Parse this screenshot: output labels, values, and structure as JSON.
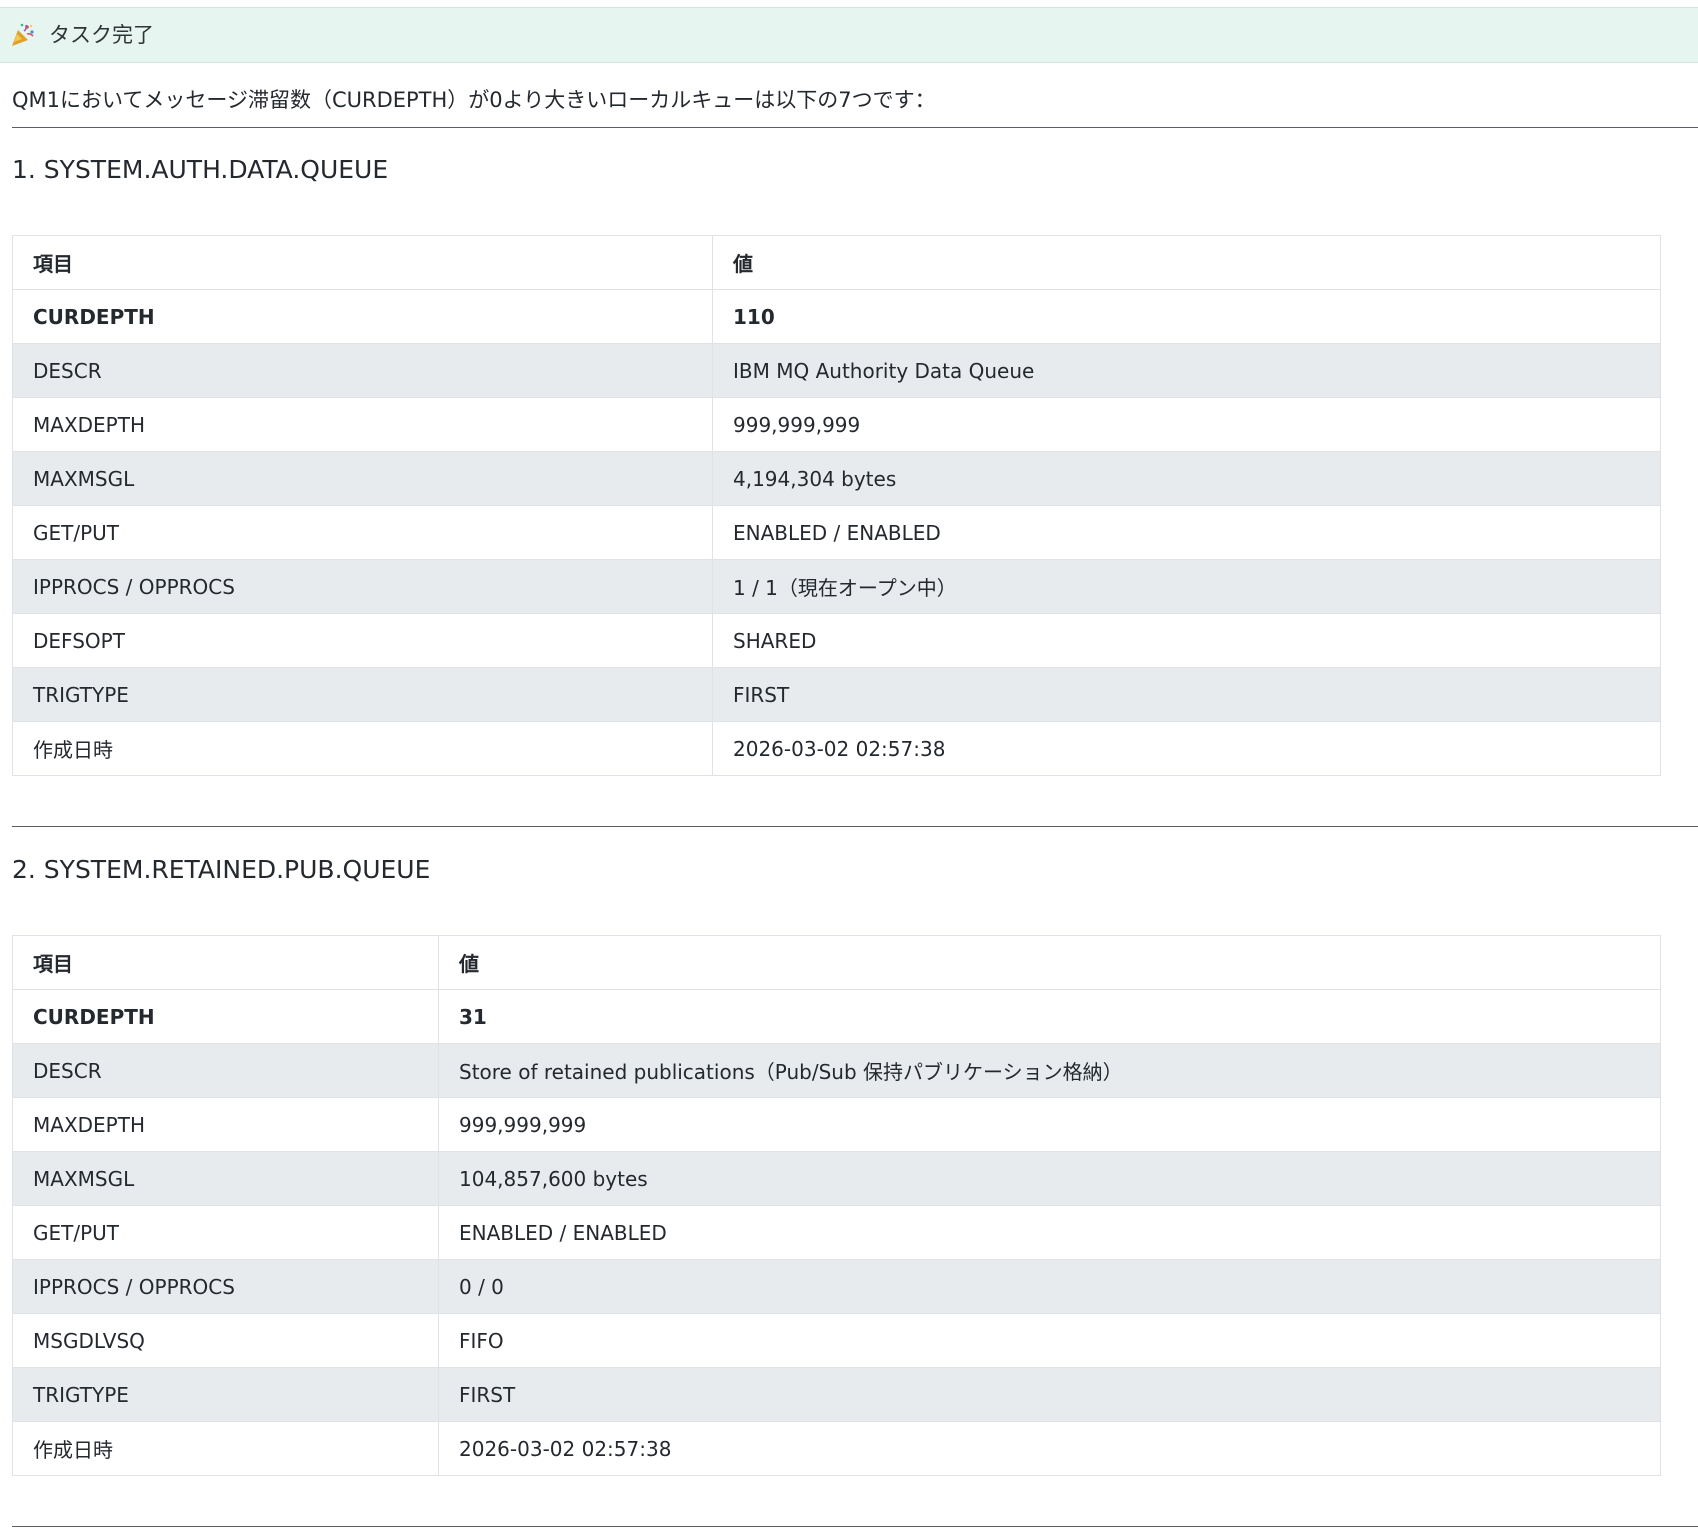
{
  "banner": {
    "icon": "party-popper-icon",
    "title": "タスク完了"
  },
  "intro": "QM1においてメッセージ滞留数（CURDEPTH）が0より大きいローカルキューは以下の7つです：",
  "sections": [
    {
      "title": "1. SYSTEM.AUTH.DATA.QUEUE",
      "header": {
        "key": "項目",
        "value": "値"
      },
      "rows": [
        {
          "key": "CURDEPTH",
          "value": "110"
        },
        {
          "key": "DESCR",
          "value": "IBM MQ Authority Data Queue"
        },
        {
          "key": "MAXDEPTH",
          "value": "999,999,999"
        },
        {
          "key": "MAXMSGL",
          "value": "4,194,304 bytes"
        },
        {
          "key": "GET/PUT",
          "value": "ENABLED / ENABLED"
        },
        {
          "key": "IPPROCS / OPPROCS",
          "value": "1 / 1（現在オープン中）"
        },
        {
          "key": "DEFSOPT",
          "value": "SHARED"
        },
        {
          "key": "TRIGTYPE",
          "value": "FIRST"
        },
        {
          "key": "作成日時",
          "value": "2026-03-02 02:57:38"
        }
      ]
    },
    {
      "title": "2. SYSTEM.RETAINED.PUB.QUEUE",
      "header": {
        "key": "項目",
        "value": "値"
      },
      "rows": [
        {
          "key": "CURDEPTH",
          "value": "31"
        },
        {
          "key": "DESCR",
          "value": "Store of retained publications（Pub/Sub 保持パブリケーション格納）"
        },
        {
          "key": "MAXDEPTH",
          "value": "999,999,999"
        },
        {
          "key": "MAXMSGL",
          "value": "104,857,600 bytes"
        },
        {
          "key": "GET/PUT",
          "value": "ENABLED / ENABLED"
        },
        {
          "key": "IPPROCS / OPPROCS",
          "value": "0 / 0"
        },
        {
          "key": "MSGDLVSQ",
          "value": "FIFO"
        },
        {
          "key": "TRIGTYPE",
          "value": "FIRST"
        },
        {
          "key": "作成日時",
          "value": "2026-03-02 02:57:38"
        }
      ]
    }
  ]
}
